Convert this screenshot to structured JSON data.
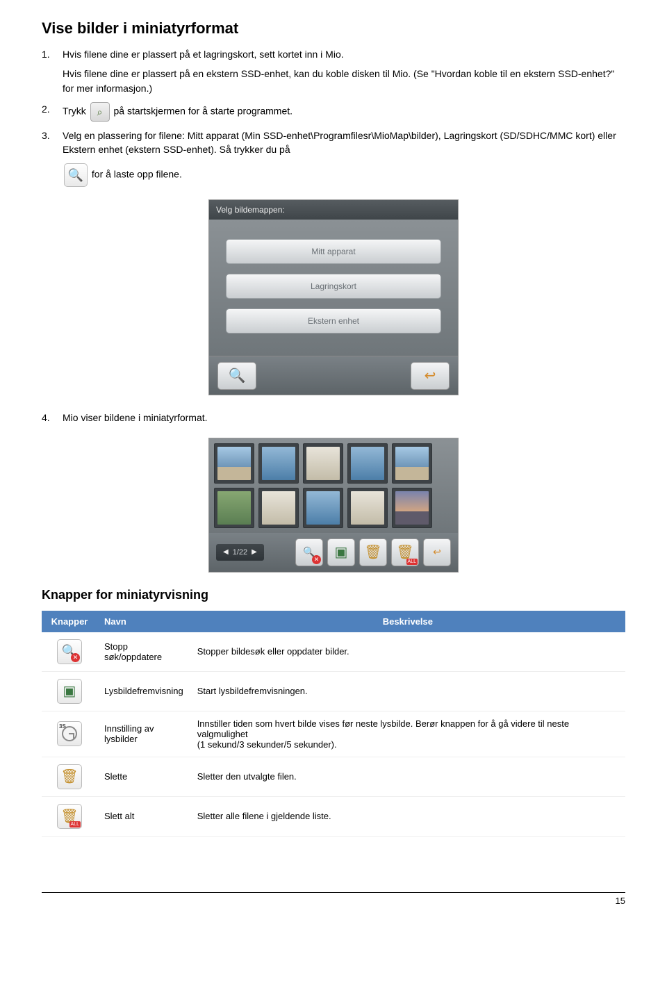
{
  "headings": {
    "main": "Vise bilder i miniatyrformat",
    "section": "Knapper for miniatyrvisning"
  },
  "steps": {
    "s1": {
      "num": "1.",
      "t1": "Hvis filene dine er plassert på et lagringskort, sett kortet inn i Mio.",
      "t2": "Hvis filene dine er plassert på en ekstern SSD-enhet, kan du koble disken til Mio. (Se \"Hvordan koble til en ekstern SSD-enhet?\" for mer informasjon.)"
    },
    "s2": {
      "num": "2.",
      "pre": "Trykk",
      "post": "på startskjermen for å starte programmet."
    },
    "s3": {
      "num": "3.",
      "t1": "Velg en plassering for filene: Mitt apparat (Min SSD-enhet\\Programfilesr\\MioMap\\bilder), Lagringskort (SD/SDHC/MMC kort) eller Ekstern enhet (ekstern SSD-enhet). Så trykker du på",
      "t2": "for å laste opp filene."
    },
    "s4": {
      "num": "4.",
      "t": "Mio viser bildene i miniatyrformat."
    }
  },
  "device_ui": {
    "header": "Velg bildemappen:",
    "buttons": {
      "b1": "Mitt apparat",
      "b2": "Lagringskort",
      "b3": "Ekstern enhet"
    }
  },
  "thumb_ui": {
    "page": "1/22"
  },
  "table": {
    "head": {
      "c1": "Knapper",
      "c2": "Navn",
      "c3": "Beskrivelse"
    },
    "rows": {
      "r1": {
        "name": "Stopp søk/oppdatere",
        "desc": "Stopper bildesøk eller oppdater bilder."
      },
      "r2": {
        "name": "Lysbildefremvisning",
        "desc": "Start lysbildefremvisningen."
      },
      "r3": {
        "name": "Innstilling av lysbilder",
        "desc": "Innstiller tiden som hvert bilde vises før neste lysbilde. Berør knappen for å gå videre til neste valgmulighet\n(1 sekund/3 sekunder/5 sekunder)."
      },
      "r4": {
        "name": "Slette",
        "desc": "Sletter den utvalgte filen."
      },
      "r5": {
        "name": "Slett alt",
        "desc": "Sletter alle filene i gjeldende liste."
      }
    },
    "timer_label": "3S",
    "all_label": "ALL"
  },
  "page_number": "15"
}
